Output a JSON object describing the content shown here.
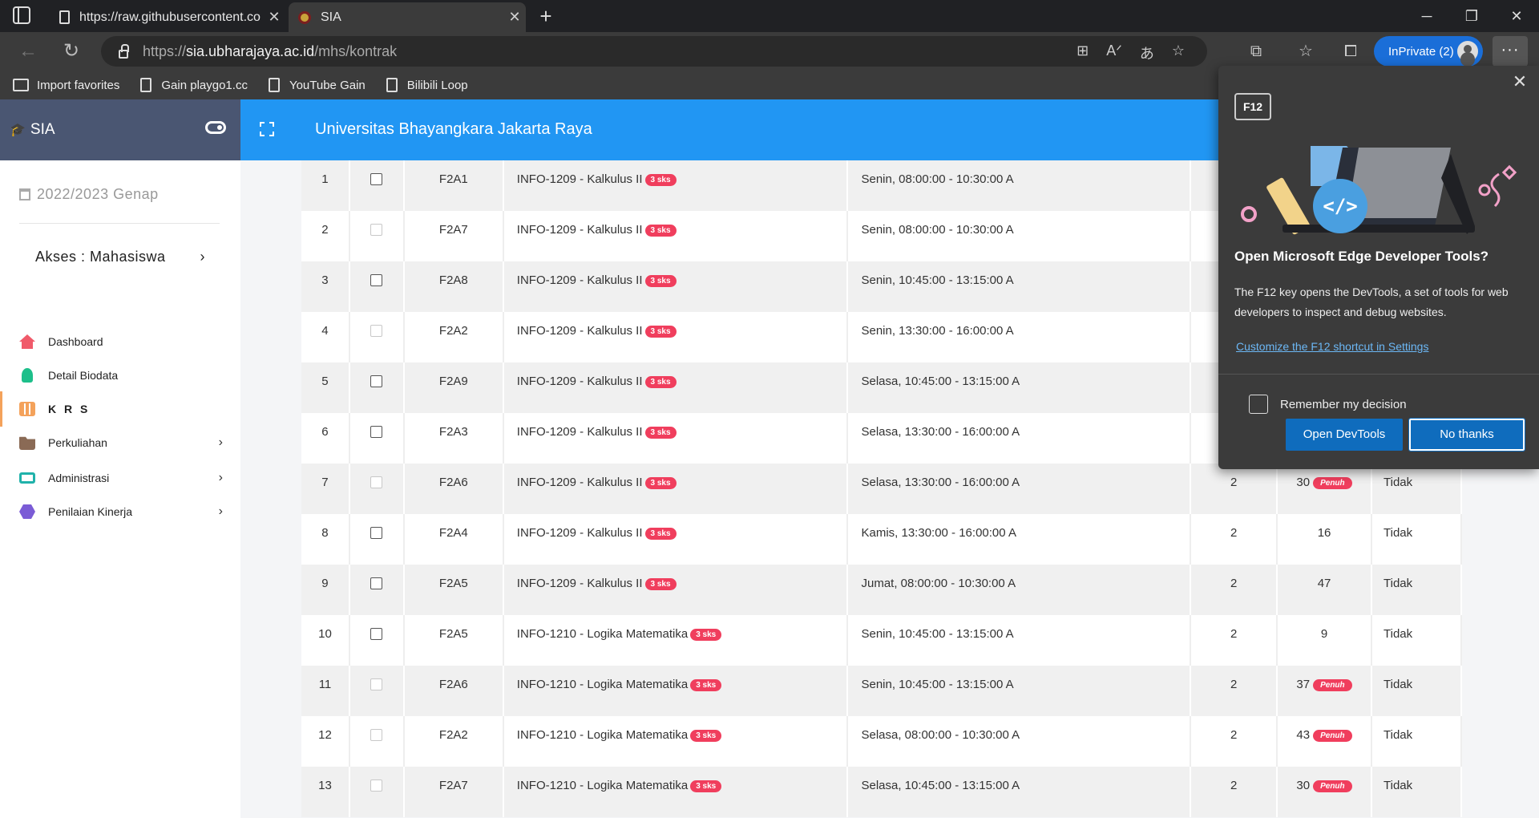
{
  "browser": {
    "tabs": [
      {
        "title": "https://raw.githubusercontent.co",
        "icon": "file-icon"
      },
      {
        "title": "SIA",
        "icon": "site-favicon"
      }
    ],
    "url_scheme": "https://",
    "url_host": "sia.ubharajaya.ac.id",
    "url_path": "/mhs/kontrak",
    "inprivate_label": "InPrivate (2)",
    "favorites": [
      "Import favorites",
      "Gain playgo1.cc",
      "YouTube Gain",
      "Bilibili Loop"
    ]
  },
  "sidebar": {
    "brand": "SIA",
    "semester": "2022/2023 Genap",
    "akses": "Akses : Mahasiswa",
    "items": [
      {
        "label": "Dashboard",
        "icon": "home-icon",
        "color": "#f05a6a"
      },
      {
        "label": "Detail Biodata",
        "icon": "user-icon",
        "color": "#1dbf8a"
      },
      {
        "label": "K R S",
        "icon": "calculator-icon",
        "color": "#f4a25b"
      },
      {
        "label": "Perkuliahan",
        "icon": "folder-icon",
        "color": "#8a6a55"
      },
      {
        "label": "Administrasi",
        "icon": "money-icon",
        "color": "#20b2aa"
      },
      {
        "label": "Penilaian Kinerja",
        "icon": "cubes-icon",
        "color": "#7b5cd6"
      }
    ]
  },
  "header": {
    "title": "Universitas Bhayangkara Jakarta Raya"
  },
  "table": {
    "rows": [
      {
        "no": "1",
        "enabled": true,
        "kelas": "F2A1",
        "mk": "INFO-1209 - Kalkulus II",
        "sks_badge": "3 sks",
        "jadwal": "Senin, 08:00:00 - 10:30:00 A",
        "sks": "",
        "kapasitas": "",
        "penuh": false,
        "status": ""
      },
      {
        "no": "2",
        "enabled": false,
        "kelas": "F2A7",
        "mk": "INFO-1209 - Kalkulus II",
        "sks_badge": "3 sks",
        "jadwal": "Senin, 08:00:00 - 10:30:00 A",
        "sks": "",
        "kapasitas": "",
        "penuh": false,
        "status": ""
      },
      {
        "no": "3",
        "enabled": true,
        "kelas": "F2A8",
        "mk": "INFO-1209 - Kalkulus II",
        "sks_badge": "3 sks",
        "jadwal": "Senin, 10:45:00 - 13:15:00 A",
        "sks": "",
        "kapasitas": "",
        "penuh": false,
        "status": ""
      },
      {
        "no": "4",
        "enabled": false,
        "kelas": "F2A2",
        "mk": "INFO-1209 - Kalkulus II",
        "sks_badge": "3 sks",
        "jadwal": "Senin, 13:30:00 - 16:00:00 A",
        "sks": "",
        "kapasitas": "",
        "penuh": false,
        "status": ""
      },
      {
        "no": "5",
        "enabled": true,
        "kelas": "F2A9",
        "mk": "INFO-1209 - Kalkulus II",
        "sks_badge": "3 sks",
        "jadwal": "Selasa, 10:45:00 - 13:15:00 A",
        "sks": "",
        "kapasitas": "",
        "penuh": false,
        "status": ""
      },
      {
        "no": "6",
        "enabled": true,
        "kelas": "F2A3",
        "mk": "INFO-1209 - Kalkulus II",
        "sks_badge": "3 sks",
        "jadwal": "Selasa, 13:30:00 - 16:00:00 A",
        "sks": "",
        "kapasitas": "",
        "penuh": false,
        "status": ""
      },
      {
        "no": "7",
        "enabled": false,
        "kelas": "F2A6",
        "mk": "INFO-1209 - Kalkulus II",
        "sks_badge": "3 sks",
        "jadwal": "Selasa, 13:30:00 - 16:00:00 A",
        "sks": "2",
        "kapasitas": "30",
        "penuh": true,
        "status": "Tidak"
      },
      {
        "no": "8",
        "enabled": true,
        "kelas": "F2A4",
        "mk": "INFO-1209 - Kalkulus II",
        "sks_badge": "3 sks",
        "jadwal": "Kamis, 13:30:00 - 16:00:00 A",
        "sks": "2",
        "kapasitas": "16",
        "penuh": false,
        "status": "Tidak"
      },
      {
        "no": "9",
        "enabled": true,
        "kelas": "F2A5",
        "mk": "INFO-1209 - Kalkulus II",
        "sks_badge": "3 sks",
        "jadwal": "Jumat, 08:00:00 - 10:30:00 A",
        "sks": "2",
        "kapasitas": "47",
        "penuh": false,
        "status": "Tidak"
      },
      {
        "no": "10",
        "enabled": true,
        "kelas": "F2A5",
        "mk": "INFO-1210 - Logika Matematika",
        "sks_badge": "3 sks",
        "jadwal": "Senin, 10:45:00 - 13:15:00 A",
        "sks": "2",
        "kapasitas": "9",
        "penuh": false,
        "status": "Tidak"
      },
      {
        "no": "11",
        "enabled": false,
        "kelas": "F2A6",
        "mk": "INFO-1210 - Logika Matematika",
        "sks_badge": "3 sks",
        "jadwal": "Senin, 10:45:00 - 13:15:00 A",
        "sks": "2",
        "kapasitas": "37",
        "penuh": true,
        "status": "Tidak"
      },
      {
        "no": "12",
        "enabled": false,
        "kelas": "F2A2",
        "mk": "INFO-1210 - Logika Matematika",
        "sks_badge": "3 sks",
        "jadwal": "Selasa, 08:00:00 - 10:30:00 A",
        "sks": "2",
        "kapasitas": "43",
        "penuh": true,
        "status": "Tidak"
      },
      {
        "no": "13",
        "enabled": false,
        "kelas": "F2A7",
        "mk": "INFO-1210 - Logika Matematika",
        "sks_badge": "3 sks",
        "jadwal": "Selasa, 10:45:00 - 13:15:00 A",
        "sks": "2",
        "kapasitas": "30",
        "penuh": true,
        "status": "Tidak"
      }
    ],
    "full_badge": "Penuh"
  },
  "devtools_prompt": {
    "key_label": "F12",
    "title": "Open Microsoft Edge Developer Tools?",
    "description": "The F12 key opens the DevTools, a set of tools for web developers to inspect and debug websites.",
    "link": "Customize the F12 shortcut in Settings",
    "remember": "Remember my decision",
    "open_button": "Open DevTools",
    "no_button": "No thanks"
  }
}
